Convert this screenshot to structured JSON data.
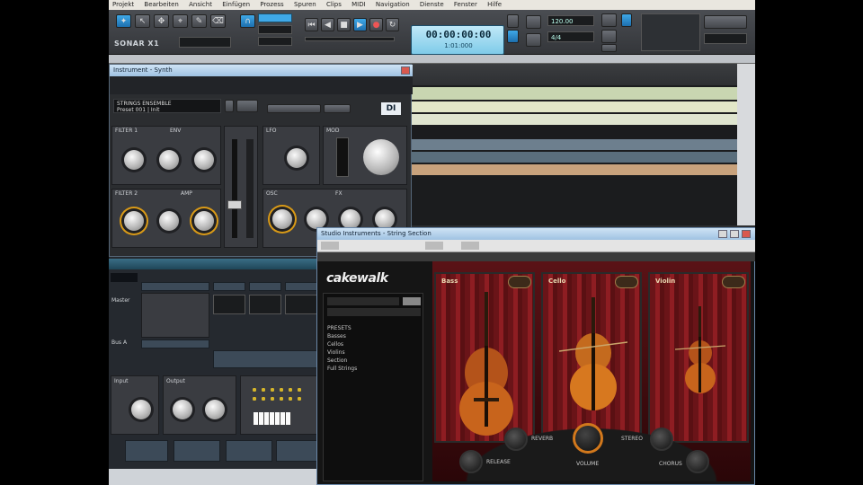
{
  "menubar": {
    "items": [
      "Projekt",
      "Bearbeiten",
      "Ansicht",
      "Einfügen",
      "Prozess",
      "Spuren",
      "Clips",
      "MIDI",
      "Navigation",
      "Dienste",
      "Fenster",
      "Hilfe"
    ]
  },
  "toolbar": {
    "product_name": "SONAR X1",
    "clock_time": "00:00:00:00",
    "clock_sub": "1:01:000",
    "tempo": "120.00",
    "meter": "4/4"
  },
  "plugin1": {
    "title": "Instrument - Synth",
    "preset_title": "STRINGS ENSEMBLE",
    "preset_sub": "Preset 001 | Init",
    "brand": "DI",
    "section_labels": [
      "FILTER 1",
      "ENV",
      "FILTER 2",
      "AMP",
      "LFO",
      "MOD",
      "OSC",
      "FX"
    ]
  },
  "plugin2": {
    "title": "Studio Instruments - String Section",
    "logo": "cakewalk",
    "menu_rows": [
      "PRESETS",
      "Basses",
      "Cellos",
      "Violins",
      "Section",
      "Full Strings"
    ],
    "instruments": [
      "Bass",
      "Cello",
      "Violin"
    ],
    "controls": [
      "REVERB",
      "RELEASE",
      "VOLUME",
      "STEREO",
      "CHORUS"
    ]
  },
  "console": {
    "labels": [
      "Master",
      "Bus A",
      "Input",
      "Output"
    ]
  },
  "colors": {
    "accent_blue": "#3fa9e8",
    "clock_bg": "#9fd8ef",
    "knob_ring": "#d99a17",
    "curtain_red": "#8e1d22",
    "wood": "#c8641c"
  }
}
